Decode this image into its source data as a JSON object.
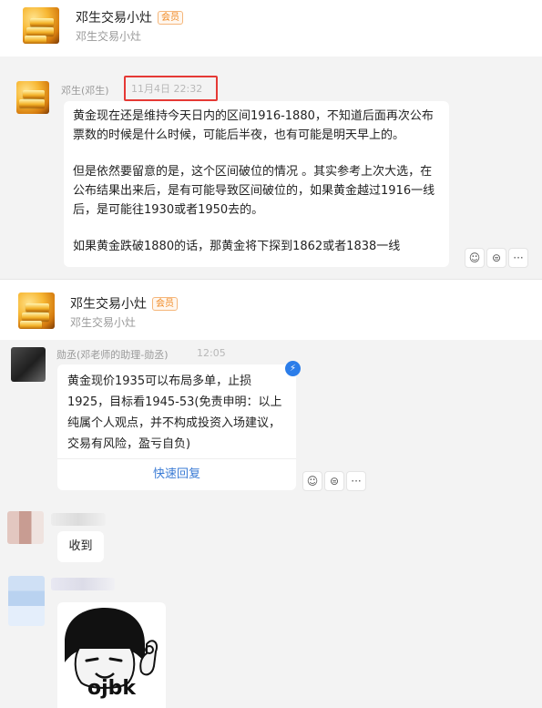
{
  "header1": {
    "title": "邓生交易小灶",
    "badge": "会员",
    "subtitle": "邓生交易小灶"
  },
  "message1": {
    "sender": "邓生(邓生)",
    "time": "11月4日 22:32",
    "paragraphs": [
      "黄金现在还是维持今天日内的区间1916-1880，不知道后面再次公布票数的时候是什么时候，可能后半夜，也有可能是明天早上的。",
      "但是依然要留意的是，这个区间破位的情况 。其实参考上次大选，在公布结果出来后，是有可能导致区间破位的，如果黄金越过1916一线后，是可能往1930或者1950去的。",
      "如果黄金跌破1880的话，那黄金将下探到1862或者1838一线"
    ]
  },
  "header2": {
    "title": "邓生交易小灶",
    "badge": "会员",
    "subtitle": "邓生交易小灶"
  },
  "message2": {
    "sender": "勋丞(邓老师的助理-勋丞)",
    "time": "12:05",
    "text": "黄金现价1935可以布局多单，止损1925，目标看1945-53(免责申明：以上纯属个人观点，并不构成投资入场建议，交易有风险，盈亏自负)",
    "quick_reply": "快速回复"
  },
  "message3": {
    "text": "收到"
  },
  "sticker": {
    "caption": "ojbk"
  },
  "actions": {
    "emoji": "☺",
    "reply": "⊜",
    "more": "···",
    "verified": "⚡"
  },
  "colors": {
    "badge": "#f08a24",
    "link": "#3a7bd5",
    "highlight_box": "#e53935"
  }
}
